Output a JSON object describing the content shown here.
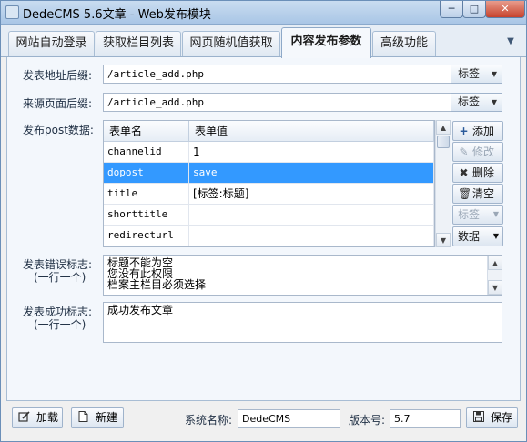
{
  "window": {
    "title": "DedeCMS 5.6文章 - Web发布模块",
    "minimize_glyph": "─",
    "maximize_glyph": "□",
    "close_glyph": "✕"
  },
  "tabs": [
    {
      "label": "网站自动登录"
    },
    {
      "label": "获取栏目列表"
    },
    {
      "label": "网页随机值获取"
    },
    {
      "label": "内容发布参数"
    },
    {
      "label": "高级功能"
    }
  ],
  "active_tab": "内容发布参数",
  "form": {
    "post_url_label": "发表地址后缀:",
    "post_url_value": "/article_add.php",
    "referer_label": "来源页面后缀:",
    "referer_value": "/article_add.php",
    "tag_button_label": "标签",
    "post_data_label": "发布post数据:",
    "error_label": "发表错误标志:",
    "error_hint": "(一行一个)",
    "error_value": "标题不能为空\n您没有此权限\n档案主栏目必须选择",
    "success_label": "发表成功标志:",
    "success_hint": "(一行一个)",
    "success_value": "成功发布文章"
  },
  "grid": {
    "columns": [
      "表单名",
      "表单值"
    ],
    "rows": [
      {
        "name": "channelid",
        "value": "1"
      },
      {
        "name": "dopost",
        "value": "save"
      },
      {
        "name": "title",
        "value": "[标签:标题]"
      },
      {
        "name": "shorttitle",
        "value": ""
      },
      {
        "name": "redirecturl",
        "value": ""
      }
    ],
    "selected_row": 1
  },
  "side_buttons": {
    "add": "添加",
    "edit": "修改",
    "delete": "删除",
    "clear": "清空",
    "tag": "标签",
    "data": "数据"
  },
  "footer": {
    "load_label": "加载",
    "new_label": "新建",
    "system_name_label": "系统名称:",
    "system_name_value": "DedeCMS",
    "version_label": "版本号:",
    "version_value": "5.7",
    "save_label": "保存"
  },
  "colors": {
    "selection": "#3399ff",
    "title_bar": "#a9c6e6",
    "close_button": "#c7432d"
  }
}
